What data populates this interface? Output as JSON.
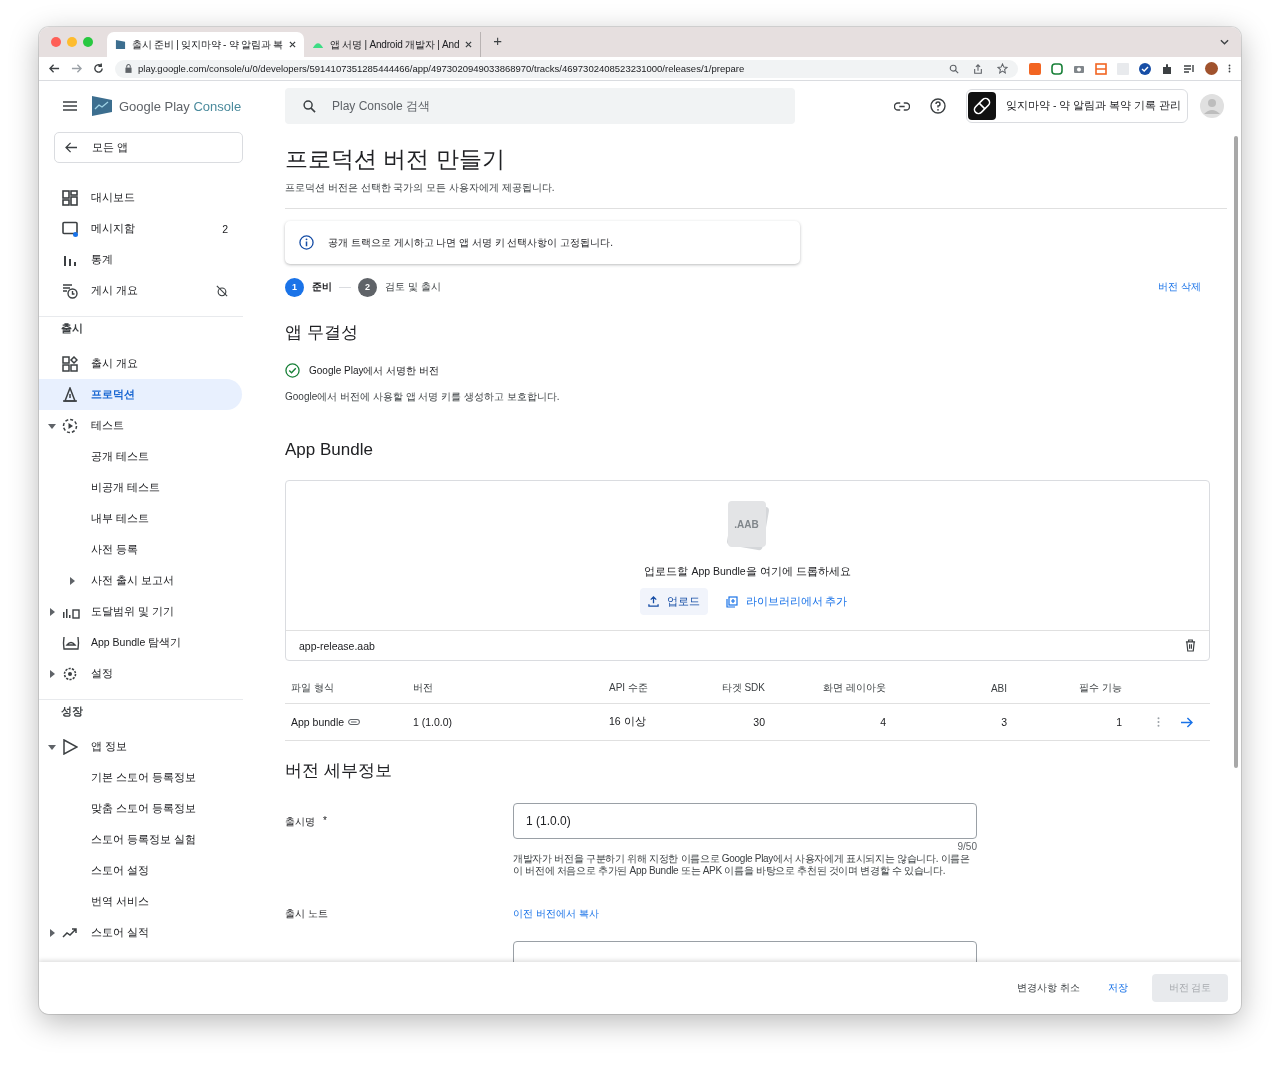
{
  "browser": {
    "tabs": [
      {
        "title": "출시 준비 | 잊지마약 - 약 알림과 복",
        "selected": true
      },
      {
        "title": "앱 서명 | Android 개발자 | And",
        "selected": false
      }
    ],
    "new_tab": "+",
    "url": "play.google.com/console/u/0/developers/5914107351285444466/app/4973020949033868970/tracks/4697302408523231000/releases/1/prepare"
  },
  "header": {
    "logo_text": "Google Play",
    "logo_product": "Console",
    "search_placeholder": "Play Console 검색",
    "app_name": "잊지마약 - 약 알림과 복약 기록 관리"
  },
  "sidebar": {
    "back": "모든 앱",
    "groups": [
      {
        "items": [
          {
            "label": "대시보드",
            "selected": false
          },
          {
            "label": "메시지함",
            "selected": false,
            "count": "2"
          },
          {
            "label": "통계",
            "selected": false
          },
          {
            "label": "게시 개요",
            "selected": false
          }
        ]
      },
      {
        "label": "출시",
        "items": [
          {
            "label": "출시 개요",
            "selected": false
          },
          {
            "label": "프로덕션",
            "selected": true
          },
          {
            "label": "테스트",
            "selected": false,
            "expanded": true,
            "children": [
              {
                "label": "공개 테스트",
                "selected": false
              },
              {
                "label": "비공개 테스트",
                "selected": false
              },
              {
                "label": "내부 테스트",
                "selected": false
              },
              {
                "label": "사전 등록",
                "selected": false
              },
              {
                "label": "사전 출시 보고서",
                "selected": false,
                "expanded": false
              }
            ]
          },
          {
            "label": "도달범위 및 기기",
            "selected": false,
            "expanded": false
          },
          {
            "label": "App Bundle 탐색기",
            "selected": false
          },
          {
            "label": "설정",
            "selected": false,
            "expanded": false
          }
        ]
      },
      {
        "label": "성장",
        "items": [
          {
            "label": "앱 정보",
            "selected": false,
            "expanded": true,
            "children": [
              {
                "label": "기본 스토어 등록정보",
                "selected": false
              },
              {
                "label": "맞춤 스토어 등록정보",
                "selected": false
              },
              {
                "label": "스토어 등록정보 실험",
                "selected": false
              },
              {
                "label": "스토어 설정",
                "selected": false
              },
              {
                "label": "번역 서비스",
                "selected": false
              }
            ]
          },
          {
            "label": "스토어 실적",
            "selected": false,
            "expanded": false
          }
        ]
      }
    ]
  },
  "page": {
    "title": "프로덕션 버전 만들기",
    "subtitle": "프로덕션 버전은 선택한 국가의 모든 사용자에게 제공됩니다.",
    "notice": "공개 트랙으로 게시하고 나면 앱 서명 키 선택사항이 고정됩니다.",
    "steps": [
      {
        "number": "1",
        "label": "준비",
        "selected": true
      },
      {
        "number": "2",
        "label": "검토 및 출시",
        "selected": false
      }
    ],
    "delete_link": "버전 삭제"
  },
  "integrity": {
    "heading": "앱 무결성",
    "status": "Google Play에서 서명한 버전",
    "description": "Google에서 버전에 사용할 앱 서명 키를 생성하고 보호합니다."
  },
  "bundle": {
    "heading": "App Bundle",
    "file_badge": ".AAB",
    "drop_text": "업로드할 App Bundle을 여기에 드롭하세요",
    "upload_button": "업로드",
    "library_button": "라이브러리에서 추가",
    "file_name": "app-release.aab",
    "columns": [
      "파일 형식",
      "버전",
      "API 수준",
      "타겟 SDK",
      "화면 레이아웃",
      "ABI",
      "필수 기능"
    ],
    "rows": [
      {
        "cells": [
          "App bundle",
          "1 (1.0.0)",
          "16 이상",
          "30",
          "4",
          "3",
          "1"
        ]
      }
    ]
  },
  "details": {
    "heading": "버전 세부정보",
    "name_label": "출시명",
    "required": "*",
    "name_value": "1 (1.0.0)",
    "counter": "9/50",
    "help": "개발자가 버전을 구분하기 위해 지정한 이름으로 Google Play에서 사용자에게 표시되지는 않습니다. 이름은 이 버전에 처음으로 추가된 App Bundle 또는 APK 이름을 바탕으로 추천된 것이며 변경할 수 있습니다.",
    "notes_label": "출시 노트",
    "copy_link": "이전 버전에서 복사"
  },
  "footer": {
    "cancel": "변경사항 취소",
    "save": "저장",
    "review": {
      "label": "버전 검토",
      "disabled": true
    }
  }
}
